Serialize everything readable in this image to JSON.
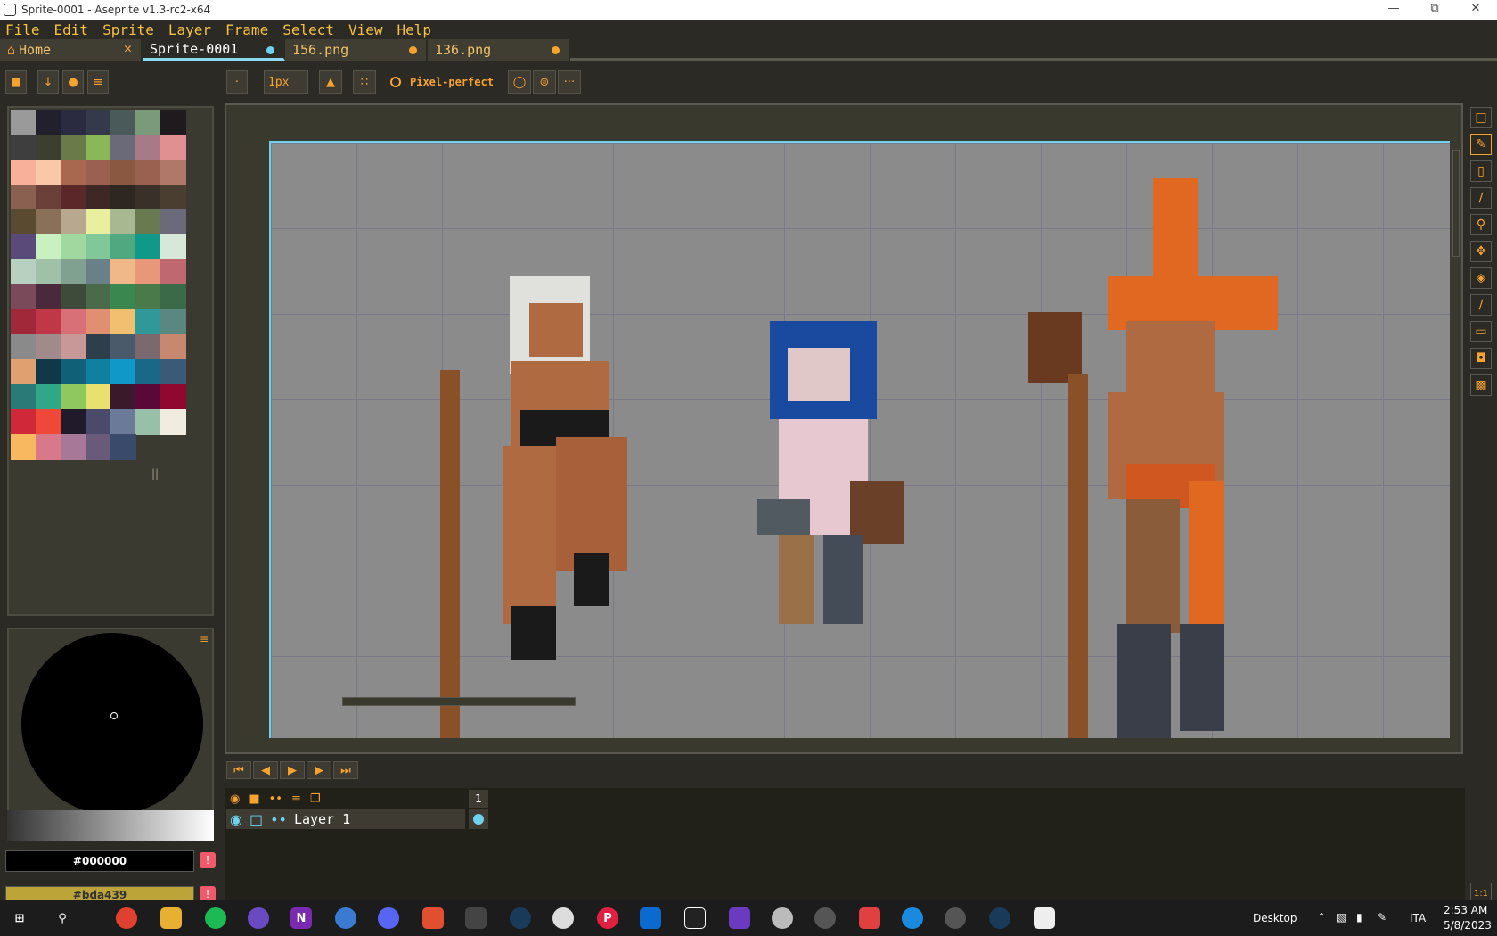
{
  "window": {
    "title": "Sprite-0001 - Aseprite v1.3-rc2-x64"
  },
  "menu": [
    "File",
    "Edit",
    "Sprite",
    "Layer",
    "Frame",
    "Select",
    "View",
    "Help"
  ],
  "tabs": [
    {
      "label": "Home",
      "state": "close",
      "active": false
    },
    {
      "label": "Sprite-0001",
      "state": "dot-blue",
      "active": true
    },
    {
      "label": "156.png",
      "state": "dot-orange",
      "active": false
    },
    {
      "label": "136.png",
      "state": "dot-orange",
      "active": false
    }
  ],
  "toolbar": {
    "brush_size": "1px",
    "pixel_perfect_label": "Pixel-perfect",
    "more_label": "···"
  },
  "palette": [
    "#9a9a9a",
    "#23202e",
    "#2a2a40",
    "#343a4a",
    "#4a5a5a",
    "#7a9a7a",
    "#1e1a1e",
    "#3e3e3e",
    "#3c3e30",
    "#6a7a48",
    "#8ab858",
    "#6a6a78",
    "#a87a88",
    "#e09090",
    "#f8b09a",
    "#f8c8a8",
    "#a86850",
    "#9a6050",
    "#8a5840",
    "#9a6050",
    "#b07868",
    "#8a6050",
    "#6a4038",
    "#5a2828",
    "#3e2826",
    "#2e2620",
    "#3a302a",
    "#4a3e30",
    "#5a4a30",
    "#8a7058",
    "#b8a890",
    "#e8f0a0",
    "#a8b890",
    "#6a7a50",
    "#6a6a7a",
    "#5a4a7a",
    "#c8f0c0",
    "#a0d8a0",
    "#80c898",
    "#50a880",
    "#109888",
    "#d8e8d8",
    "#b8d0c0",
    "#a0c0a8",
    "#80a090",
    "#6a8088",
    "#f0b888",
    "#e89878",
    "#c06870",
    "#7a4a5a",
    "#4a2a3a",
    "#3e4a3a",
    "#4a6a4a",
    "#3a8850",
    "#4a7a4a",
    "#3a6a48",
    "#a02838",
    "#c03848",
    "#d87078",
    "#e09070",
    "#f0c070",
    "#309898",
    "#5a8880",
    "#8a8a8a",
    "#a08a8a",
    "#c89898",
    "#2e3e4a",
    "#4a5a6a",
    "#7a6a70",
    "#c88870",
    "#e0a070",
    "#103848",
    "#106078",
    "#1080a0",
    "#1098c8",
    "#1a6888",
    "#3a5a78",
    "#2a7a78",
    "#30a888",
    "#90c860",
    "#e8e070",
    "#3a1a2a",
    "#5a0838",
    "#900830",
    "#d02838",
    "#f04838",
    "#201a2a",
    "#4a4a6a",
    "#6a7a98",
    "#98c0a8",
    "#f0ece0",
    "#f8b860",
    "#d87888",
    "#a87898",
    "#6a5a7a",
    "#3a4a6a"
  ],
  "color": {
    "fg_hex": "#000000",
    "bg_hex": "#bda439",
    "fg": "#000000",
    "bg": "#bda439"
  },
  "timeline": {
    "frame_number": "1",
    "layer_name": "Layer 1"
  },
  "taskbar": {
    "desktop_label": "Desktop",
    "lang": "ITA",
    "time": "2:53 AM",
    "date": "5/8/2023"
  },
  "theme": {
    "accent": "#f7a330",
    "selection": "#6fd1ee",
    "panel": "#2b2a24"
  }
}
